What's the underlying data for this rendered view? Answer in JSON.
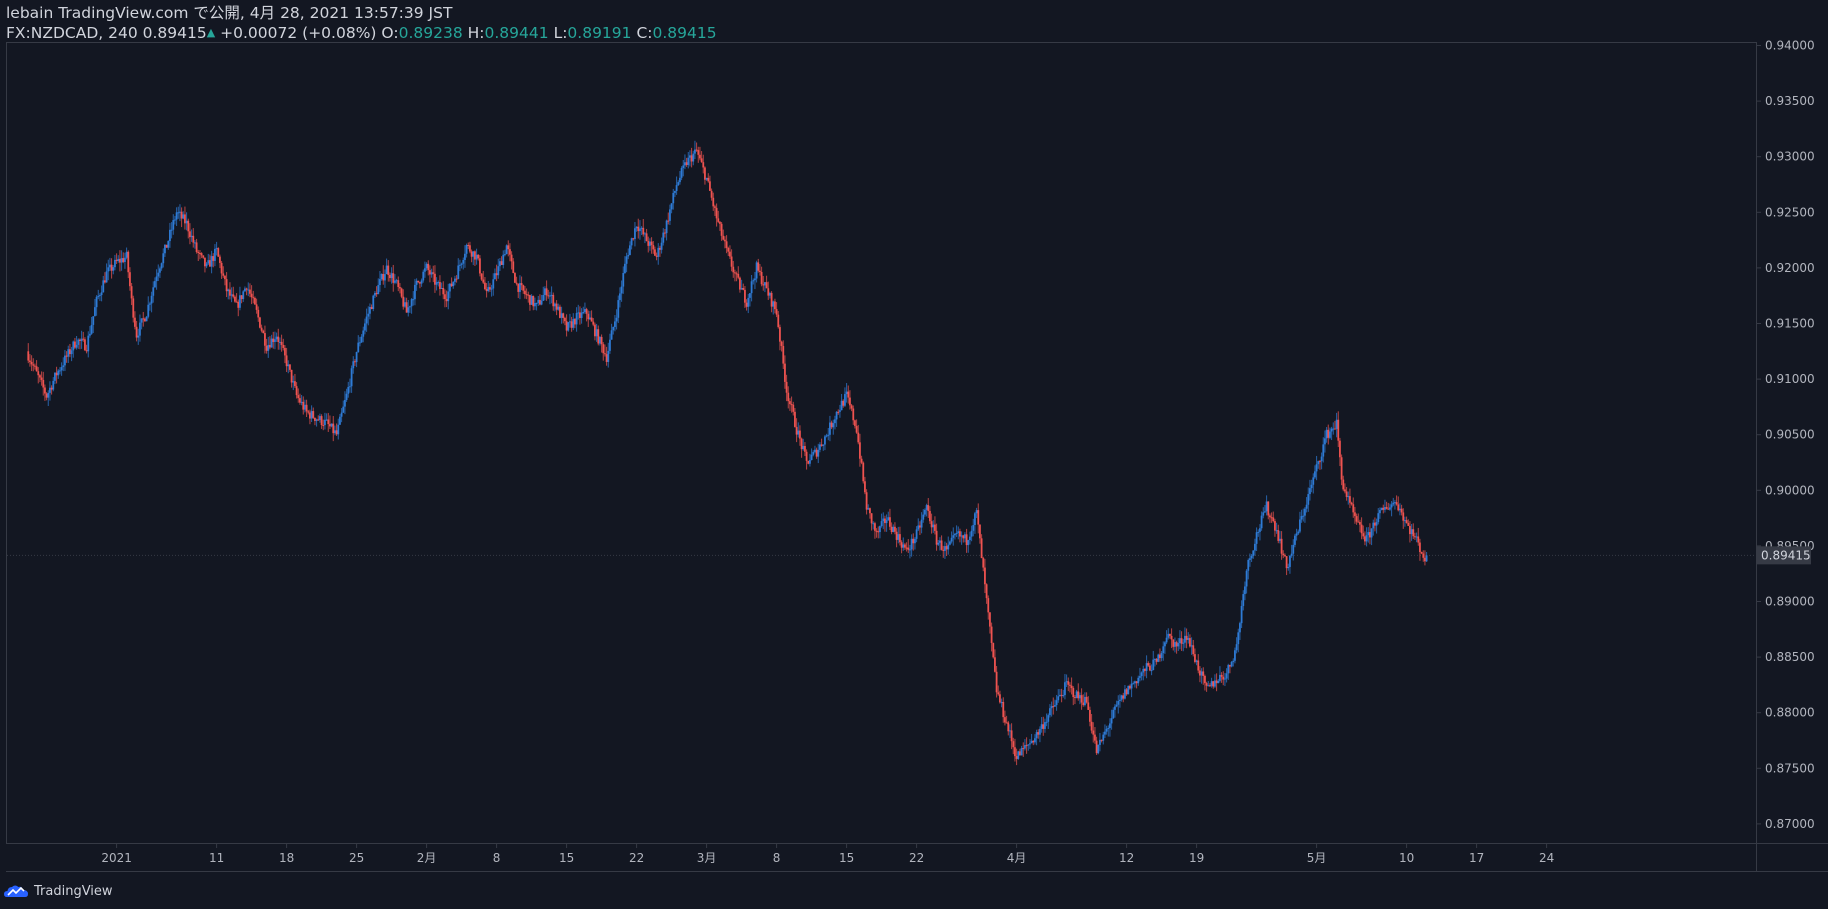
{
  "header": {
    "published_line": "lebain TradingView.com で公開, 4月 28, 2021 13:57:39 JST",
    "symbol_line": "FX:NZDCAD, 240 0.89415",
    "change": "+0.00072 (+0.08%)",
    "o_label": "O:",
    "o_value": "0.89238",
    "h_label": "H:",
    "h_value": "0.89441",
    "l_label": "L:",
    "l_value": "0.89191",
    "c_label": "C:",
    "c_value": "0.89415"
  },
  "footer": {
    "brand": "TradingView"
  },
  "colors": {
    "background": "#131722",
    "up": "#2962ff",
    "up_light": "#2e7bd6",
    "down": "#ef5350",
    "axis_text": "#b2b5be",
    "border": "#363a45",
    "last_price_bg": "#363a45"
  },
  "chart_data": {
    "type": "candlestick",
    "symbol": "FX:NZDCAD",
    "interval": "240",
    "last_price": 0.89415,
    "last_price_label": "0.89415",
    "ylim": [
      0.8675,
      0.94
    ],
    "y_ticks": [
      "0.94000",
      "0.93500",
      "0.93000",
      "0.92500",
      "0.92000",
      "0.91500",
      "0.91000",
      "0.90500",
      "0.90000",
      "0.89500",
      "0.89000",
      "0.88500",
      "0.88000",
      "0.87500",
      "0.87000"
    ],
    "x_ticks": [
      {
        "label": "2021",
        "day": 0
      },
      {
        "label": "11",
        "day": 10
      },
      {
        "label": "18",
        "day": 17
      },
      {
        "label": "25",
        "day": 24
      },
      {
        "label": "2月",
        "day": 31
      },
      {
        "label": "8",
        "day": 38
      },
      {
        "label": "15",
        "day": 45
      },
      {
        "label": "22",
        "day": 52
      },
      {
        "label": "3月",
        "day": 59
      },
      {
        "label": "8",
        "day": 66
      },
      {
        "label": "15",
        "day": 73
      },
      {
        "label": "22",
        "day": 80
      },
      {
        "label": "4月",
        "day": 90
      },
      {
        "label": "12",
        "day": 101
      },
      {
        "label": "19",
        "day": 108
      },
      {
        "label": "5月",
        "day": 120
      },
      {
        "label": "10",
        "day": 129
      },
      {
        "label": "17",
        "day": 136
      },
      {
        "label": "24",
        "day": 143
      }
    ],
    "path": [
      [
        -9,
        0.9125
      ],
      [
        -7,
        0.9085
      ],
      [
        -6,
        0.9105
      ],
      [
        -4,
        0.9135
      ],
      [
        -3,
        0.913
      ],
      [
        -2,
        0.917
      ],
      [
        -1,
        0.9195
      ],
      [
        0,
        0.9205
      ],
      [
        1,
        0.921
      ],
      [
        1.5,
        0.917
      ],
      [
        2,
        0.914
      ],
      [
        3,
        0.916
      ],
      [
        4,
        0.9195
      ],
      [
        5,
        0.922
      ],
      [
        6,
        0.925
      ],
      [
        7,
        0.924
      ],
      [
        8,
        0.9215
      ],
      [
        9,
        0.92
      ],
      [
        10,
        0.9215
      ],
      [
        11,
        0.918
      ],
      [
        12,
        0.9165
      ],
      [
        13,
        0.9185
      ],
      [
        14,
        0.916
      ],
      [
        15,
        0.913
      ],
      [
        16,
        0.914
      ],
      [
        17,
        0.9115
      ],
      [
        18,
        0.9085
      ],
      [
        19,
        0.907
      ],
      [
        20,
        0.9065
      ],
      [
        21,
        0.906
      ],
      [
        22,
        0.905
      ],
      [
        23,
        0.9085
      ],
      [
        24,
        0.9125
      ],
      [
        25,
        0.9155
      ],
      [
        26,
        0.918
      ],
      [
        27,
        0.92
      ],
      [
        28,
        0.9185
      ],
      [
        29,
        0.916
      ],
      [
        30,
        0.9185
      ],
      [
        31,
        0.92
      ],
      [
        32,
        0.9185
      ],
      [
        33,
        0.9175
      ],
      [
        34,
        0.9195
      ],
      [
        35,
        0.922
      ],
      [
        36,
        0.921
      ],
      [
        37,
        0.9175
      ],
      [
        38,
        0.9195
      ],
      [
        39,
        0.922
      ],
      [
        40,
        0.9185
      ],
      [
        41,
        0.9175
      ],
      [
        42,
        0.9165
      ],
      [
        43,
        0.918
      ],
      [
        44,
        0.9165
      ],
      [
        45,
        0.9145
      ],
      [
        46,
        0.9155
      ],
      [
        47,
        0.916
      ],
      [
        48,
        0.914
      ],
      [
        49,
        0.912
      ],
      [
        50,
        0.916
      ],
      [
        51,
        0.921
      ],
      [
        52,
        0.924
      ],
      [
        53,
        0.9225
      ],
      [
        54,
        0.921
      ],
      [
        55,
        0.924
      ],
      [
        56,
        0.9275
      ],
      [
        57,
        0.9295
      ],
      [
        58,
        0.9305
      ],
      [
        59,
        0.928
      ],
      [
        60,
        0.9245
      ],
      [
        61,
        0.9215
      ],
      [
        62,
        0.919
      ],
      [
        63,
        0.917
      ],
      [
        64,
        0.92
      ],
      [
        65,
        0.918
      ],
      [
        66,
        0.916
      ],
      [
        67,
        0.909
      ],
      [
        68,
        0.9055
      ],
      [
        69,
        0.9025
      ],
      [
        70,
        0.9035
      ],
      [
        71,
        0.905
      ],
      [
        72,
        0.907
      ],
      [
        73,
        0.9085
      ],
      [
        74,
        0.9055
      ],
      [
        75,
        0.8985
      ],
      [
        76,
        0.896
      ],
      [
        77,
        0.8975
      ],
      [
        78,
        0.896
      ],
      [
        79,
        0.8945
      ],
      [
        80,
        0.896
      ],
      [
        81,
        0.8985
      ],
      [
        82,
        0.8955
      ],
      [
        83,
        0.8945
      ],
      [
        84,
        0.896
      ],
      [
        85,
        0.8955
      ],
      [
        86,
        0.898
      ],
      [
        87,
        0.89
      ],
      [
        88,
        0.882
      ],
      [
        89,
        0.879
      ],
      [
        90,
        0.876
      ],
      [
        91,
        0.877
      ],
      [
        92,
        0.878
      ],
      [
        93,
        0.8795
      ],
      [
        94,
        0.881
      ],
      [
        95,
        0.8825
      ],
      [
        96,
        0.8815
      ],
      [
        97,
        0.881
      ],
      [
        98,
        0.8765
      ],
      [
        99,
        0.8785
      ],
      [
        100,
        0.8805
      ],
      [
        101,
        0.882
      ],
      [
        102,
        0.883
      ],
      [
        103,
        0.884
      ],
      [
        104,
        0.8845
      ],
      [
        105,
        0.887
      ],
      [
        106,
        0.886
      ],
      [
        107,
        0.887
      ],
      [
        108,
        0.8845
      ],
      [
        109,
        0.882
      ],
      [
        110,
        0.883
      ],
      [
        111,
        0.8835
      ],
      [
        112,
        0.886
      ],
      [
        113,
        0.893
      ],
      [
        114,
        0.896
      ],
      [
        115,
        0.8985
      ],
      [
        116,
        0.8965
      ],
      [
        117,
        0.893
      ],
      [
        118,
        0.896
      ],
      [
        119,
        0.899
      ],
      [
        120,
        0.902
      ],
      [
        121,
        0.905
      ],
      [
        122,
        0.906
      ],
      [
        122.5,
        0.901
      ],
      [
        123,
        0.8995
      ],
      [
        124,
        0.897
      ],
      [
        125,
        0.8955
      ],
      [
        126,
        0.8975
      ],
      [
        127,
        0.8985
      ],
      [
        128,
        0.899
      ],
      [
        129,
        0.897
      ],
      [
        130,
        0.8955
      ],
      [
        131,
        0.8935
      ]
    ]
  }
}
